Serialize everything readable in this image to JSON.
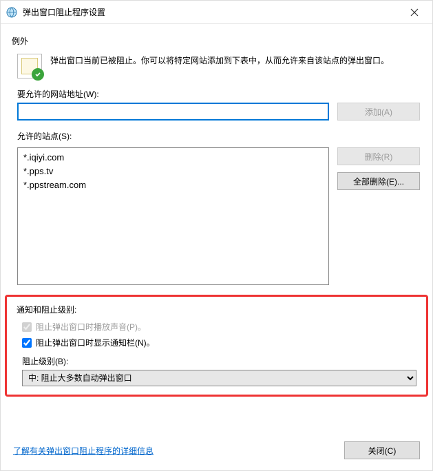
{
  "titlebar": {
    "title": "弹出窗口阻止程序设置"
  },
  "exceptions": {
    "section_label": "例外",
    "description": "弹出窗口当前已被阻止。你可以将特定网站添加到下表中，从而允许来自该站点的弹出窗口。",
    "address_label": "要允许的网站地址(W):",
    "address_value": "",
    "add_button": "添加(A)",
    "allowed_label": "允许的站点(S):",
    "sites": [
      "*.iqiyi.com",
      "*.pps.tv",
      "*.ppstream.com"
    ],
    "remove_button": "删除(R)",
    "remove_all_button": "全部删除(E)..."
  },
  "notification": {
    "group_title": "通知和阻止级别:",
    "play_sound_label": "阻止弹出窗口时播放声音(P)。",
    "play_sound_checked": true,
    "show_bar_label": "阻止弹出窗口时显示通知栏(N)。",
    "show_bar_checked": true,
    "level_label": "阻止级别(B):",
    "level_value": "中: 阻止大多数自动弹出窗口"
  },
  "footer": {
    "link": "了解有关弹出窗口阻止程序的详细信息",
    "close_button": "关闭(C)"
  }
}
